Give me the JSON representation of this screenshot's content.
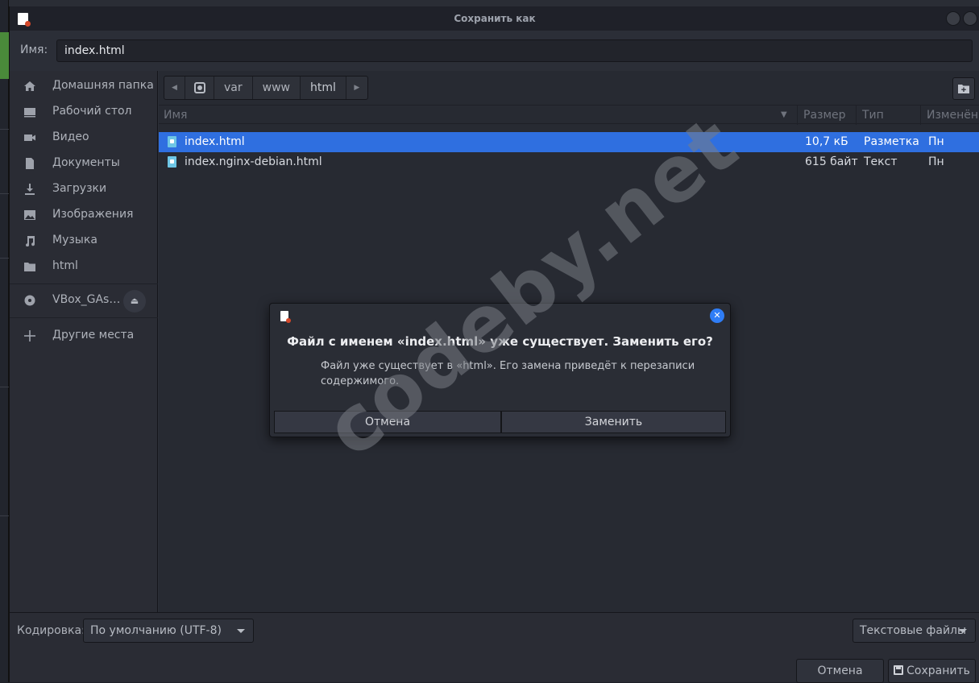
{
  "window": {
    "title": "Сохранить как"
  },
  "name_field": {
    "label": "Имя:",
    "value": "index.html"
  },
  "sidebar": {
    "items": [
      {
        "label": "Домашняя папка",
        "icon": "home-icon"
      },
      {
        "label": "Рабочий стол",
        "icon": "desktop-icon"
      },
      {
        "label": "Видео",
        "icon": "video-icon"
      },
      {
        "label": "Документы",
        "icon": "document-icon"
      },
      {
        "label": "Загрузки",
        "icon": "download-icon"
      },
      {
        "label": "Изображения",
        "icon": "image-icon"
      },
      {
        "label": "Музыка",
        "icon": "music-icon"
      },
      {
        "label": "html",
        "icon": "folder-icon"
      }
    ],
    "device": {
      "label": "VBox_GAs…",
      "icon": "disc-icon"
    },
    "other": {
      "label": "Другие места",
      "icon": "plus-icon"
    }
  },
  "pathbar": {
    "crumbs": [
      "var",
      "www",
      "html"
    ]
  },
  "columns": {
    "name": "Имя",
    "size": "Размер",
    "type": "Тип",
    "modified": "Изменён"
  },
  "files": [
    {
      "name": "index.html",
      "size": "10,7 кБ",
      "type": "Разметка",
      "modified": "Пн",
      "selected": true
    },
    {
      "name": "index.nginx-debian.html",
      "size": "615 байт",
      "type": "Текст",
      "modified": "Пн",
      "selected": false
    }
  ],
  "bottom": {
    "encoding_label": "Кодировка:",
    "encoding_value": "По умолчанию (UTF-8)",
    "filter_value": "Текстовые файлы",
    "cancel_label": "Отмена",
    "save_label": "Сохранить"
  },
  "dialog": {
    "title": "Файл с именем «index.html» уже существует. Заменить его?",
    "message": "Файл уже существует в «html». Его замена приведёт к перезаписи содержимого.",
    "cancel_label": "Отмена",
    "replace_label": "Заменить"
  },
  "watermark": "codeby.net",
  "colors": {
    "selection": "#2f6fe0",
    "close_button": "#2f7df6"
  }
}
